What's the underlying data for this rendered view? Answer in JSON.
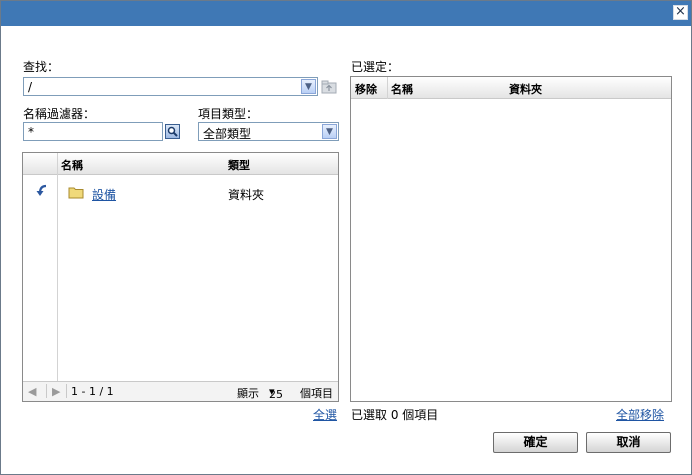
{
  "titlebar": {
    "close_icon": "×"
  },
  "lookin": {
    "label": "查找：",
    "value": "/"
  },
  "name_filter": {
    "label": "名稱過濾器：",
    "value": "*"
  },
  "item_type": {
    "label": "項目類型：",
    "value": "全部類型"
  },
  "browse_grid": {
    "columns": [
      "名稱",
      "類型"
    ],
    "rows": [
      {
        "name": "設備",
        "type": "資料夾"
      }
    ],
    "pager": {
      "range": "1 - 1 / 1",
      "show_label": "顯示",
      "page_size": "25",
      "items_label": "個項目"
    }
  },
  "select_all_link": "全選",
  "selected": {
    "label": "已選定：",
    "columns": [
      "移除",
      "名稱",
      "資料夾"
    ],
    "count_text": "已選取 0 個項目",
    "remove_all_link": "全部移除"
  },
  "buttons": {
    "ok": "確定",
    "cancel": "取消"
  },
  "colors": {
    "titlebar": "#3f78b5",
    "link": "#1f55a3"
  }
}
